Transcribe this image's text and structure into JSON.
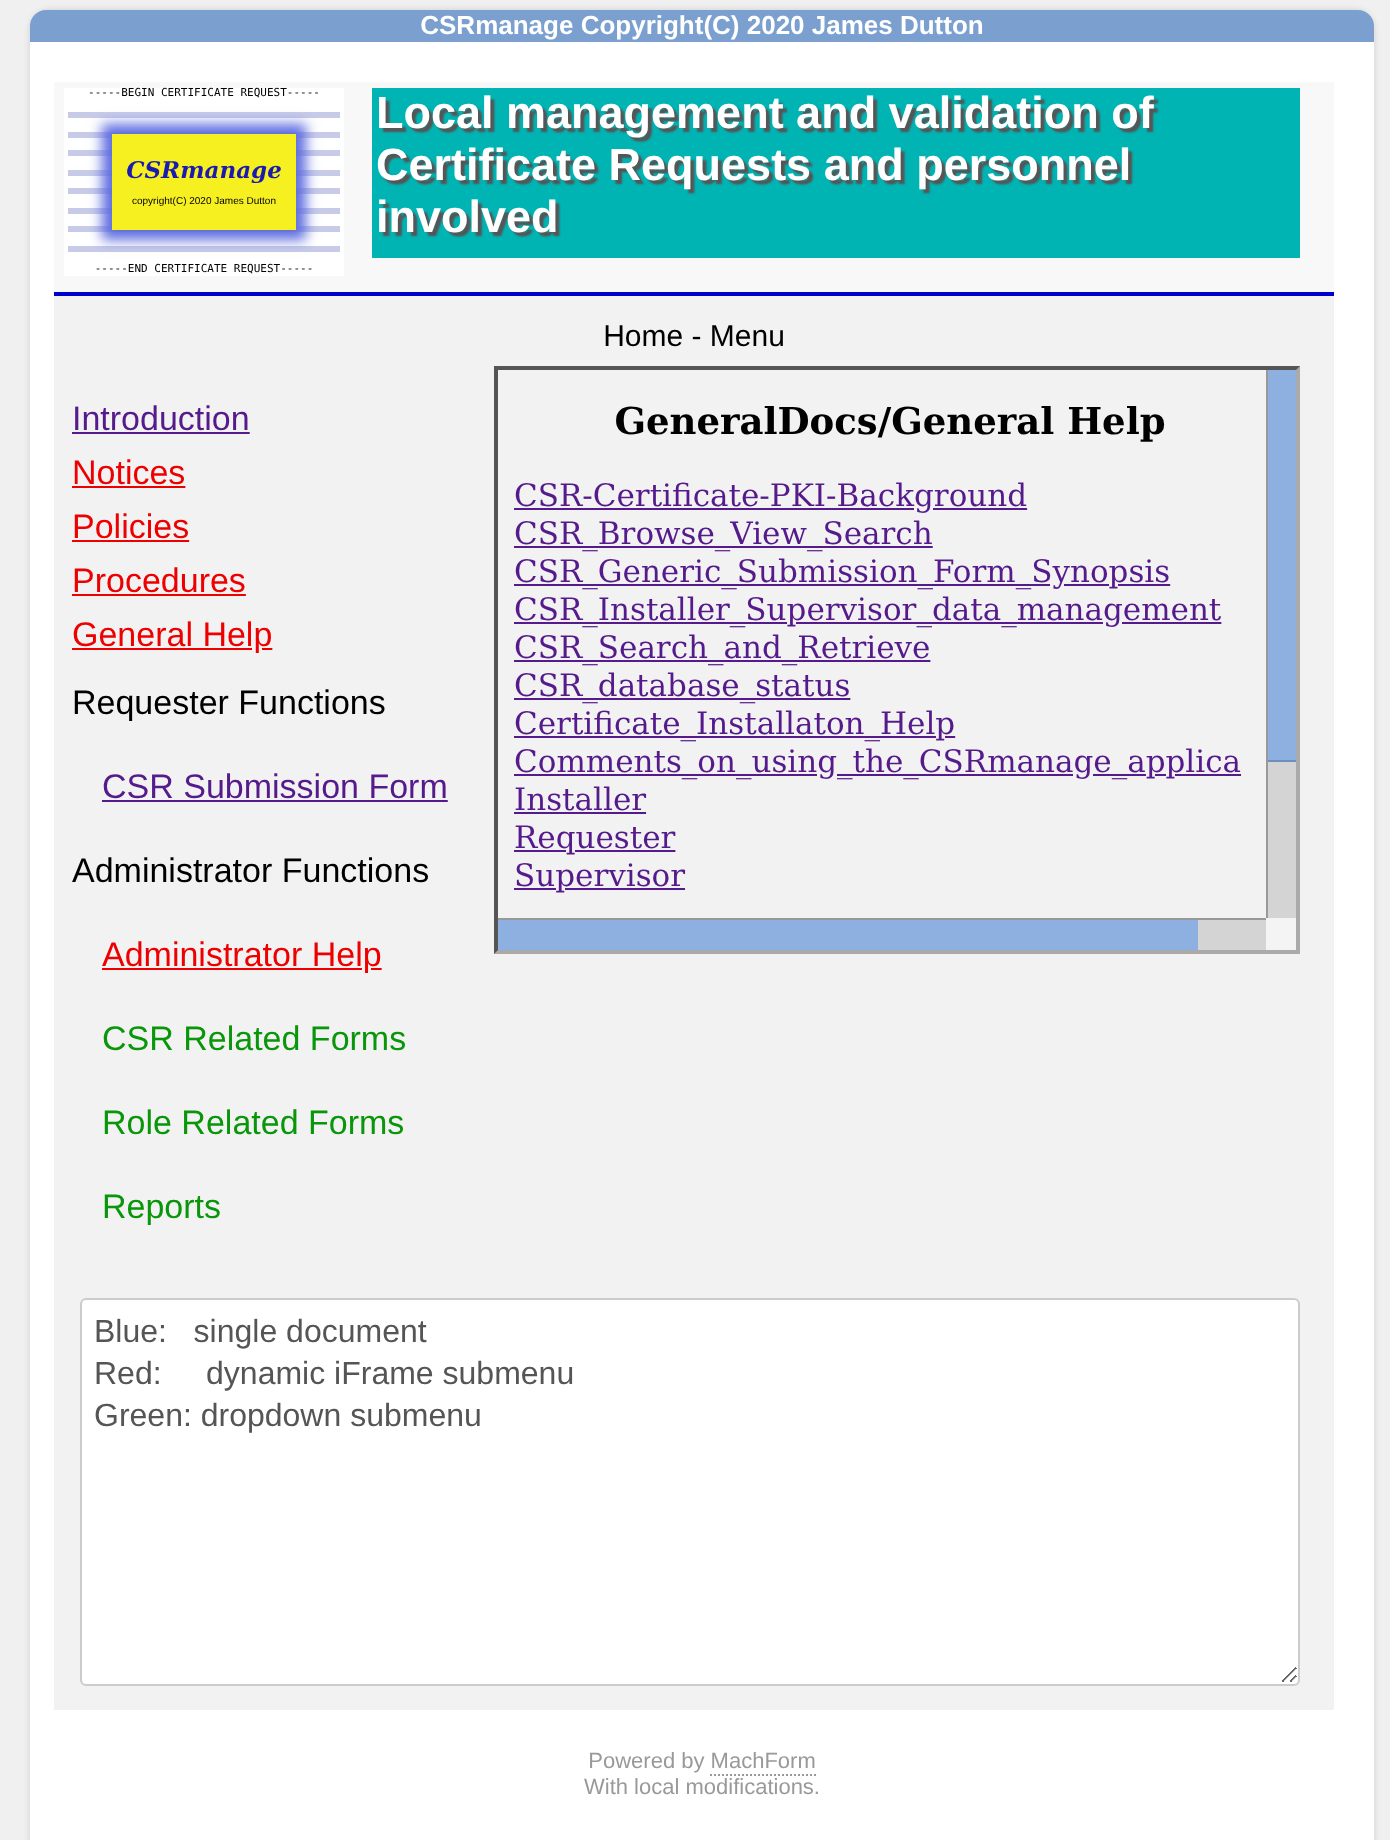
{
  "window": {
    "title": "CSRmanage Copyright(C) 2020 James Dutton"
  },
  "logo": {
    "top_line": "-----BEGIN CERTIFICATE REQUEST-----",
    "name": "CSRmanage",
    "copyright": "copyright(C) 2020 James Dutton",
    "bottom_line": "-----END CERTIFICATE REQUEST-----"
  },
  "banner": "Local management and validation of Certificate Requests and personnel involved",
  "breadcrumb": "Home - Menu",
  "menu": [
    {
      "label": "Introduction",
      "kind": "doc"
    },
    {
      "label": "Notices",
      "kind": "iframe"
    },
    {
      "label": "Policies",
      "kind": "iframe"
    },
    {
      "label": "Procedures",
      "kind": "iframe"
    },
    {
      "label": "General Help",
      "kind": "iframe"
    },
    {
      "label": "Requester Functions",
      "kind": "heading",
      "children": [
        {
          "label": "CSR Submission Form",
          "kind": "doc"
        }
      ]
    },
    {
      "label": "Administrator Functions",
      "kind": "heading",
      "children": [
        {
          "label": "Administrator Help",
          "kind": "iframe"
        },
        {
          "label": "CSR Related Forms",
          "kind": "dropdown"
        },
        {
          "label": "Role Related Forms",
          "kind": "dropdown"
        },
        {
          "label": "Reports",
          "kind": "dropdown"
        }
      ]
    }
  ],
  "frame": {
    "title": "GeneralDocs/General Help",
    "links": [
      "CSR-Certificate-PKI-Background",
      "CSR_Browse_View_Search",
      "CSR_Generic_Submission_Form_Synopsis",
      "CSR_Installer_Supervisor_data_management",
      "CSR_Search_and_Retrieve",
      "CSR_database_status",
      "Certificate_Installaton_Help",
      "Comments_on_using_the_CSRmanage_applica",
      "Installer",
      "Requester",
      "Supervisor"
    ]
  },
  "legend": {
    "value": "Blue:   single document\nRed:     dynamic iFrame submenu\nGreen: dropdown submenu"
  },
  "footer": {
    "prefix": "Powered by",
    "link": "MachForm",
    "note": "With local modifications."
  }
}
